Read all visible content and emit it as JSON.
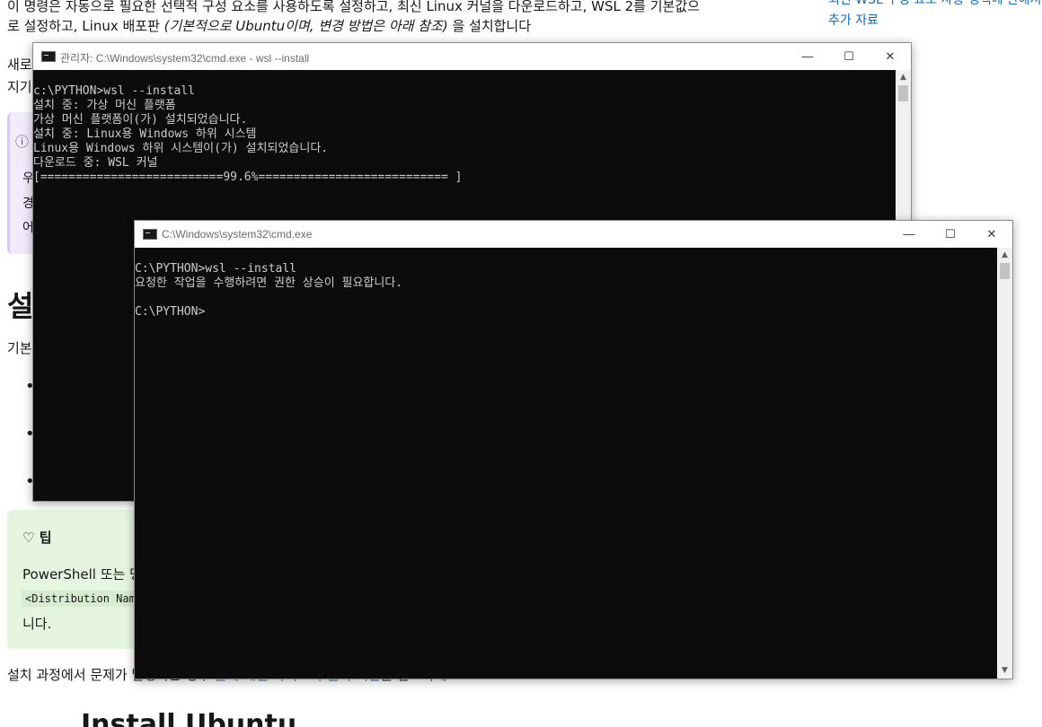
{
  "doc": {
    "line1": "이 명령은 자동으로 필요한 선택적 구성 요소를 사용하도록 설정하고, 최신 Linux 커널을 다운로드하고, WSL 2를 기본값으",
    "line2_a": "로 설정하고, Linux 배포판 ",
    "line2_em": "(기본적으로 Ubuntu이며, 변경 방법은 아래 참조)",
    "line2_b": " 을 설치합니다",
    "side_link_1": "최신 WSL 구성 요소 사용 정책에 관해서",
    "side_link_2": "추가 자료",
    "left_frag_1": "새로",
    "left_frag_2": "지기",
    "note_icon": "info-circle-icon",
    "note_frag_1": "우",
    "note_frag_2": "경",
    "note_frag_3": "어",
    "heading_frag": "설",
    "body_frag": "기본",
    "bullet_glyph": "•",
    "tip_icon": "lightbulb-icon",
    "tip_title": "팁",
    "tip_line1": "PowerShell 또는 명",
    "tip_code": "<Distribution Nam",
    "tip_line3": "니다.",
    "bottom_text_a": "설치 과정에서 문제가 발생하는 경우 ",
    "bottom_link": "문제 해결 가이드의 설치 섹션",
    "bottom_text_b": "을 참조하세요.",
    "bottom_heading": "Install Ubuntu"
  },
  "window_admin": {
    "title": "관리자: C:\\Windows\\system32\\cmd.exe - wsl  --install",
    "icon": "cmd-app-icon",
    "minimize": "—",
    "maximize": "☐",
    "close": "✕",
    "lines": [
      "c:\\PYTHON>wsl --install",
      "설치 중: 가상 머신 플랫폼",
      "가상 머신 플랫폼이(가) 설치되었습니다.",
      "설치 중: Linux용 Windows 하위 시스템",
      "Linux용 Windows 하위 시스템이(가) 설치되었습니다.",
      "다운로드 중: WSL 커널",
      "[==========================99.6%=========================== ]"
    ]
  },
  "window_user": {
    "title": "C:\\Windows\\system32\\cmd.exe",
    "icon": "cmd-app-icon",
    "minimize": "—",
    "maximize": "☐",
    "close": "✕",
    "lines": [
      "C:\\PYTHON>wsl --install",
      "요청한 작업을 수행하려면 권한 상승이 필요합니다.",
      "",
      "C:\\PYTHON>"
    ]
  },
  "colors": {
    "console_bg": "#0c0c0c",
    "console_fg": "#cccccc",
    "link": "#0f6cbd",
    "note_bg": "#f1ebfc",
    "tip_bg": "#e5f5df"
  }
}
